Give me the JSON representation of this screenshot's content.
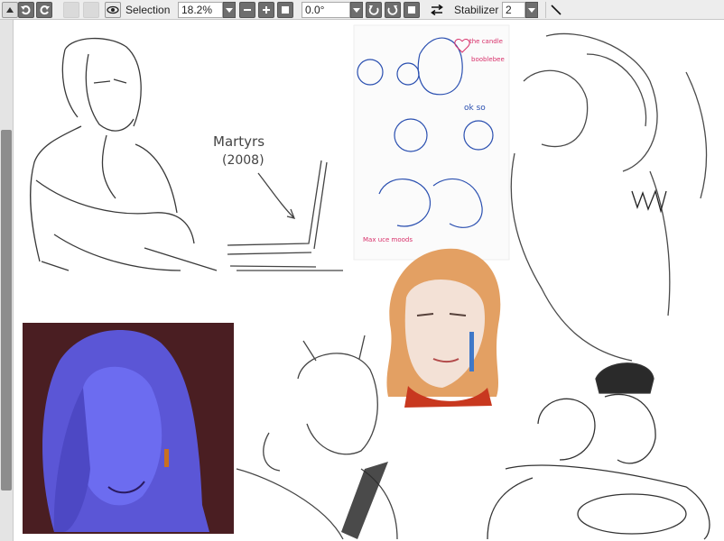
{
  "toolbar": {
    "selection_label": "Selection",
    "zoom_value": "18.2%",
    "rotation_value": "0.0°",
    "stabilizer_label": "Stabilizer",
    "stabilizer_value": "2"
  },
  "canvas": {
    "text_martyrs": "Martyrs",
    "text_year": "(2008)"
  },
  "colors": {
    "toolbar_bg": "#ededed",
    "button_dark": "#6e6e6e",
    "scroll_thumb": "#8d8d8d",
    "sketch_blue": "#2a4fb0",
    "sketch_pink": "#d8306a",
    "portrait_bg": "#4a1e22",
    "portrait_face": "#6c6cf0",
    "hair_orange": "#e3a063"
  }
}
